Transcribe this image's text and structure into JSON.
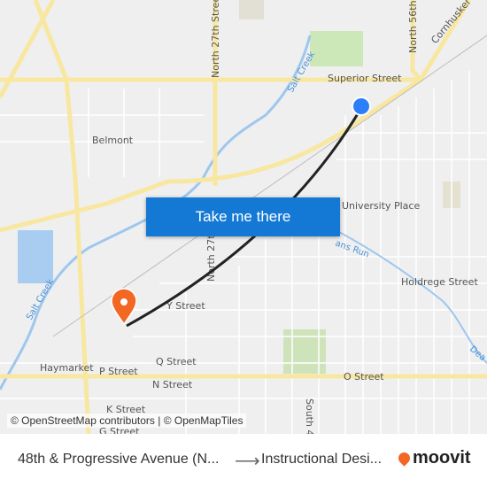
{
  "map": {
    "labels": {
      "north_27th_street": "North 27th Street",
      "north_56th": "North 56th",
      "cornhusker": "Cornhusker Hig",
      "superior": "Superior Street",
      "salt_creek_1": "Salt Creek",
      "salt_creek_2": "Salt Creek",
      "belmont": "Belmont",
      "university_place": "University Place",
      "holdrege": "Holdrege Street",
      "deadmans_run": "ans Run",
      "dea": "Dea",
      "y_street": "Y Street",
      "north_27th": "North 27th",
      "q_street": "Q Street",
      "p_street": "P Street",
      "n_street": "N Street",
      "o_street": "O Street",
      "k_street": "K Street",
      "g_street": "G Street",
      "haymarket": "Haymarket",
      "south_4": "South 4"
    },
    "origin_marker_color": "#2d7ff9",
    "destination_marker_color": "#f26722",
    "route_color": "#222222",
    "attribution": "© OpenStreetMap contributors | © OpenMapTiles"
  },
  "cta": {
    "label": "Take me there",
    "color": "#1479d4"
  },
  "footer": {
    "from": "48th & Progressive Avenue (N...",
    "arrow": "⟶",
    "to": "Instructional Desi...",
    "logo": "moovit"
  }
}
